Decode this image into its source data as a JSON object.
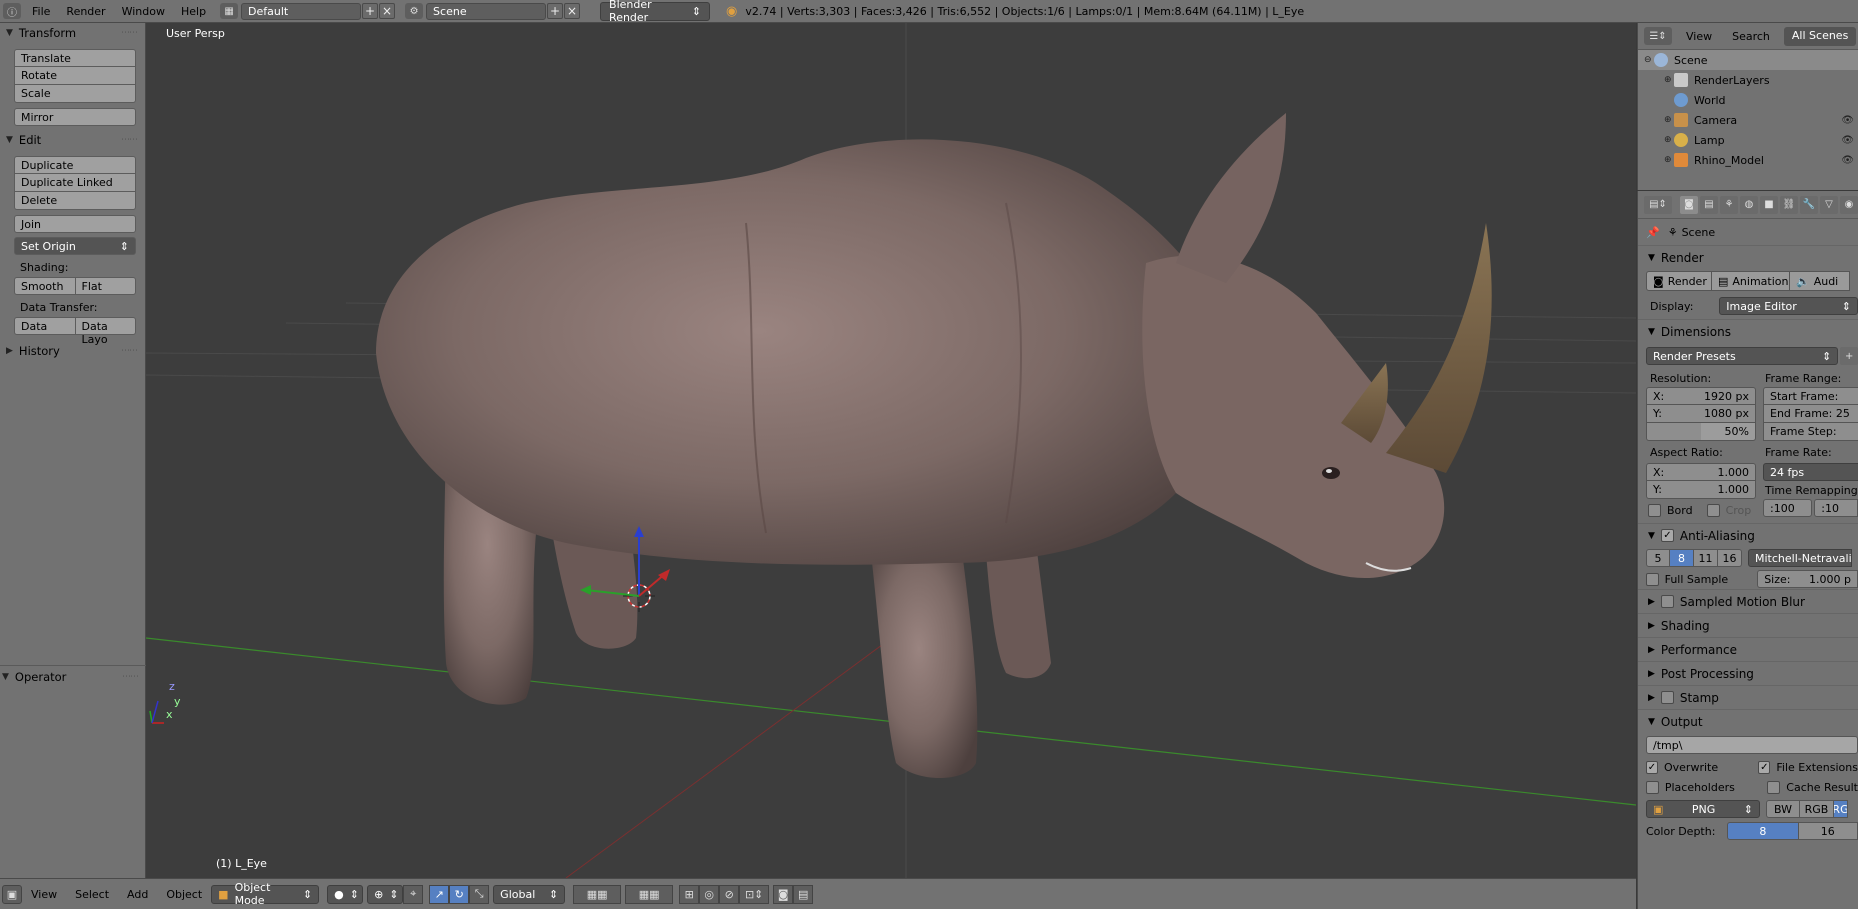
{
  "topbar": {
    "menus": [
      "File",
      "Render",
      "Window",
      "Help"
    ],
    "layout_name": "Default",
    "scene_name": "Scene",
    "render_engine": "Blender Render",
    "stats": "v2.74 | Verts:3,303 | Faces:3,426 | Tris:6,552 | Objects:1/6 | Lamps:0/1 | Mem:8.64M (64.11M) | L_Eye"
  },
  "toolshelf": {
    "transform": {
      "title": "Transform",
      "buttons": [
        "Translate",
        "Rotate",
        "Scale",
        "Mirror"
      ]
    },
    "edit": {
      "title": "Edit",
      "buttons": [
        "Duplicate",
        "Duplicate Linked",
        "Delete",
        "Join"
      ],
      "set_origin": "Set Origin",
      "shading_label": "Shading:",
      "shading": [
        "Smooth",
        "Flat"
      ],
      "data_transfer_label": "Data Transfer:",
      "data_transfer": [
        "Data",
        "Data Layo"
      ]
    },
    "history": "History",
    "operator": "Operator"
  },
  "viewport": {
    "view_label": "User Persp",
    "object_label": "(1) L_Eye",
    "axis_x": "x",
    "axis_y": "y",
    "axis_z": "z"
  },
  "bottombar": {
    "menus": [
      "View",
      "Select",
      "Add",
      "Object"
    ],
    "mode": "Object Mode",
    "orientation": "Global"
  },
  "outliner": {
    "menus": [
      "View",
      "Search"
    ],
    "filter": "All Scenes",
    "items": [
      {
        "label": "Scene",
        "color": "#9bb6d8"
      },
      {
        "label": "RenderLayers",
        "color": "#c9c9c9"
      },
      {
        "label": "World",
        "color": "#6e9bd0"
      },
      {
        "label": "Camera",
        "color": "#c8914a"
      },
      {
        "label": "Lamp",
        "color": "#d8b04a"
      },
      {
        "label": "Rhino_Model",
        "color": "#e08a3a"
      }
    ]
  },
  "properties": {
    "breadcrumb": "Scene",
    "render": {
      "title": "Render",
      "buttons": [
        "Render",
        "Animation",
        "Audi"
      ],
      "display_label": "Display:",
      "display_value": "Image Editor"
    },
    "dimensions": {
      "title": "Dimensions",
      "presets": "Render Presets",
      "resolution_label": "Resolution:",
      "res_x_label": "X:",
      "res_x": "1920 px",
      "res_y_label": "Y:",
      "res_y": "1080 px",
      "res_pct": "50%",
      "frame_range_label": "Frame Range:",
      "start_frame": "Start Frame:",
      "end_frame": "End Frame: 25",
      "frame_step": "Frame Step:",
      "aspect_label": "Aspect Ratio:",
      "aspect_x_label": "X:",
      "aspect_x": "1.000",
      "aspect_y_label": "Y:",
      "aspect_y": "1.000",
      "frame_rate_label": "Frame Rate:",
      "frame_rate": "24 fps",
      "time_remap_label": "Time Remapping",
      "remap_old": ":100",
      "remap_new": ":10",
      "bord": "Bord",
      "crop": "Crop"
    },
    "antialiasing": {
      "title": "Anti-Aliasing",
      "samples": [
        "5",
        "8",
        "11",
        "16"
      ],
      "active_sample": "8",
      "filter": "Mitchell-Netravali",
      "full_sample": "Full Sample",
      "size_label": "Size:",
      "size_value": "1.000 p"
    },
    "sections": [
      "Sampled Motion Blur",
      "Shading",
      "Performance",
      "Post Processing",
      "Stamp"
    ],
    "output": {
      "title": "Output",
      "path": "/tmp\\",
      "overwrite": "Overwrite",
      "file_extensions": "File Extensions",
      "placeholders": "Placeholders",
      "cache_result": "Cache Result",
      "format": "PNG",
      "color_modes": [
        "BW",
        "RGB",
        "RG"
      ],
      "color_depth_label": "Color Depth:",
      "color_depths": [
        "8",
        "16"
      ]
    }
  }
}
